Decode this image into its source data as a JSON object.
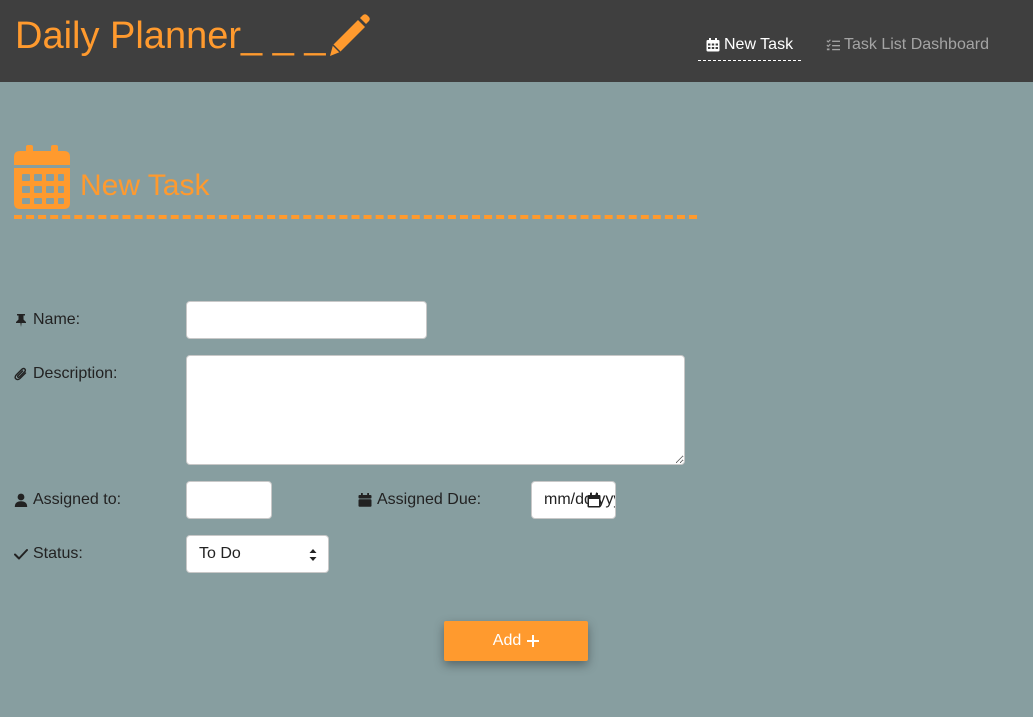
{
  "header": {
    "brand": "Daily Planner_ _ _",
    "brand_icon": "pencil-icon",
    "nav": [
      {
        "label": "New Task",
        "icon": "calendar-grid-icon",
        "active": true
      },
      {
        "label": "Task List Dashboard",
        "icon": "checklist-icon",
        "active": false
      }
    ]
  },
  "page": {
    "title": "New Task",
    "title_icon": "calendar-icon"
  },
  "form": {
    "name": {
      "label": "Name:",
      "icon": "thumbtack-icon",
      "value": ""
    },
    "description": {
      "label": "Description:",
      "icon": "paperclip-icon",
      "value": ""
    },
    "assigned_to": {
      "label": "Assigned to:",
      "icon": "user-icon",
      "value": ""
    },
    "assigned_due": {
      "label": "Assigned Due:",
      "icon": "calendar-icon",
      "value": "mm/dd/yyyy"
    },
    "status": {
      "label": "Status:",
      "icon": "check-icon",
      "value": "To Do"
    },
    "submit_label": "Add"
  },
  "colors": {
    "accent": "#ff9a2e",
    "header_bg": "#3f3f3f",
    "page_bg": "#879ea0"
  }
}
